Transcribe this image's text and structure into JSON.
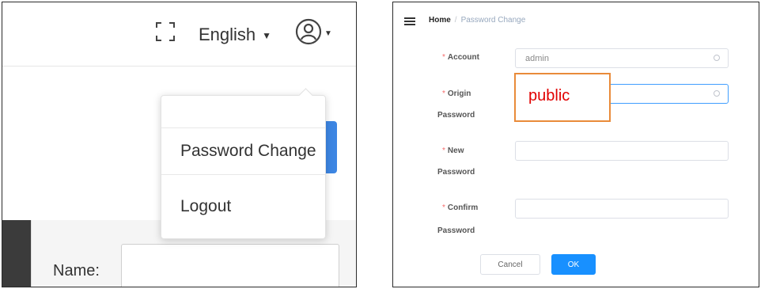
{
  "left": {
    "language": "English",
    "icons": {
      "fullscreen": "fullscreen-icon",
      "user": "user-circle-icon",
      "caret": "caret-down-icon"
    },
    "menu": {
      "password_change": "Password Change",
      "logout": "Logout"
    },
    "form": {
      "name_label": "Name:"
    }
  },
  "right": {
    "breadcrumb": {
      "home": "Home",
      "separator": "/",
      "current": "Password Change"
    },
    "form": {
      "account_label": "Account",
      "account_value": "admin",
      "origin_label_1": "Origin",
      "origin_label_2": "Password",
      "new_label_1": "New",
      "new_label_2": "Password",
      "confirm_label_1": "Confirm",
      "confirm_label_2": "Password",
      "required_mark": "*"
    },
    "annotation_text": "public",
    "buttons": {
      "cancel": "Cancel",
      "ok": "OK"
    }
  },
  "colors": {
    "primary": "#1890ff",
    "accent_tab": "#3d86e3",
    "annotation_border": "#e98b3a",
    "annotation_text": "#e10000",
    "required": "#f56c6c"
  }
}
